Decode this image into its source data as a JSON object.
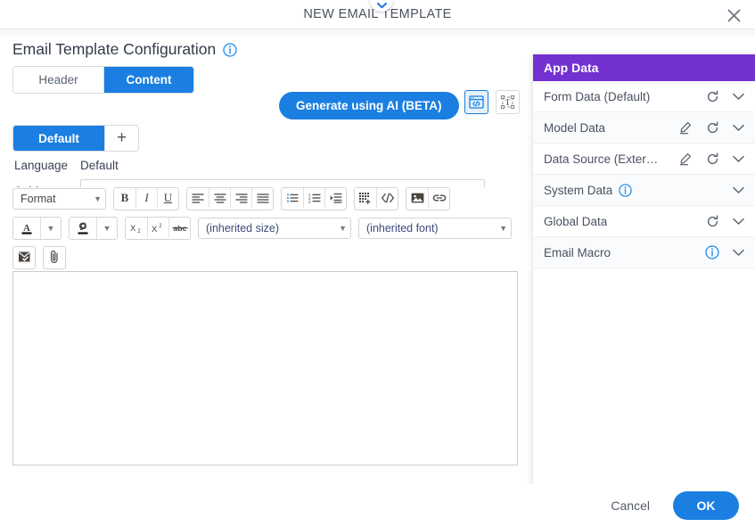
{
  "dialog": {
    "title": "NEW EMAIL TEMPLATE",
    "close_icon": "close-icon",
    "collapse_icon": "chevron-down-icon"
  },
  "page": {
    "title": "Email Template Configuration",
    "title_info_icon": "info-icon"
  },
  "section_tabs": [
    {
      "label": "Header",
      "active": false
    },
    {
      "label": "Content",
      "active": true
    }
  ],
  "language_tabs": {
    "chips": [
      {
        "label": "Default",
        "active": true
      }
    ],
    "add_label": "+"
  },
  "fields": {
    "language_label": "Language",
    "language_value": "Default",
    "subject_label": "Subject",
    "subject_value": "",
    "subject_placeholder": ""
  },
  "actions": {
    "generate_ai_label": "Generate using AI (BETA)",
    "view_source_icon": "html-source-view-icon",
    "view_text_icon": "text-box-view-icon"
  },
  "editor": {
    "format_select": "Format",
    "size_select": "(inherited size)",
    "font_select": "(inherited font)",
    "body_value": "",
    "buttons": [
      {
        "name": "bold-button",
        "label": "B"
      },
      {
        "name": "italic-button",
        "label": "I"
      },
      {
        "name": "underline-button",
        "label": "U"
      },
      {
        "name": "align-left-button",
        "label": ""
      },
      {
        "name": "align-center-button",
        "label": ""
      },
      {
        "name": "align-right-button",
        "label": ""
      },
      {
        "name": "align-justify-button",
        "label": ""
      },
      {
        "name": "bulleted-list-button",
        "label": ""
      },
      {
        "name": "numbered-list-button",
        "label": ""
      },
      {
        "name": "increase-indent-button",
        "label": ""
      },
      {
        "name": "insert-table-button",
        "label": ""
      },
      {
        "name": "source-code-button",
        "label": "</>"
      },
      {
        "name": "insert-image-button",
        "label": ""
      },
      {
        "name": "insert-link-button",
        "label": ""
      },
      {
        "name": "text-color-button",
        "label": "A"
      },
      {
        "name": "highlight-color-button",
        "label": ""
      },
      {
        "name": "subscript-button",
        "label": "X₂"
      },
      {
        "name": "superscript-button",
        "label": "X²"
      },
      {
        "name": "strikethrough-button",
        "label": "abc"
      },
      {
        "name": "insert-template-button",
        "label": ""
      },
      {
        "name": "attach-file-button",
        "label": ""
      }
    ]
  },
  "app_data": {
    "header": "App Data",
    "header_color": "#7431d1",
    "rows": [
      {
        "label": "Form Data (Default)",
        "inline_info": false,
        "edit": false,
        "refresh": true,
        "info": false,
        "chevron": true
      },
      {
        "label": "Model Data",
        "inline_info": false,
        "edit": true,
        "refresh": true,
        "info": false,
        "chevron": true
      },
      {
        "label": "Data Source (Exter…",
        "inline_info": false,
        "edit": true,
        "refresh": true,
        "info": false,
        "chevron": true
      },
      {
        "label": "System Data",
        "inline_info": true,
        "edit": false,
        "refresh": false,
        "info": false,
        "chevron": true
      },
      {
        "label": "Global Data",
        "inline_info": false,
        "edit": false,
        "refresh": true,
        "info": false,
        "chevron": true
      },
      {
        "label": "Email Macro",
        "inline_info": false,
        "edit": false,
        "refresh": false,
        "info": true,
        "chevron": true
      }
    ]
  },
  "footer": {
    "cancel_label": "Cancel",
    "ok_label": "OK"
  },
  "colors": {
    "accent_blue": "#1a7fe0",
    "purple": "#7431d1"
  }
}
